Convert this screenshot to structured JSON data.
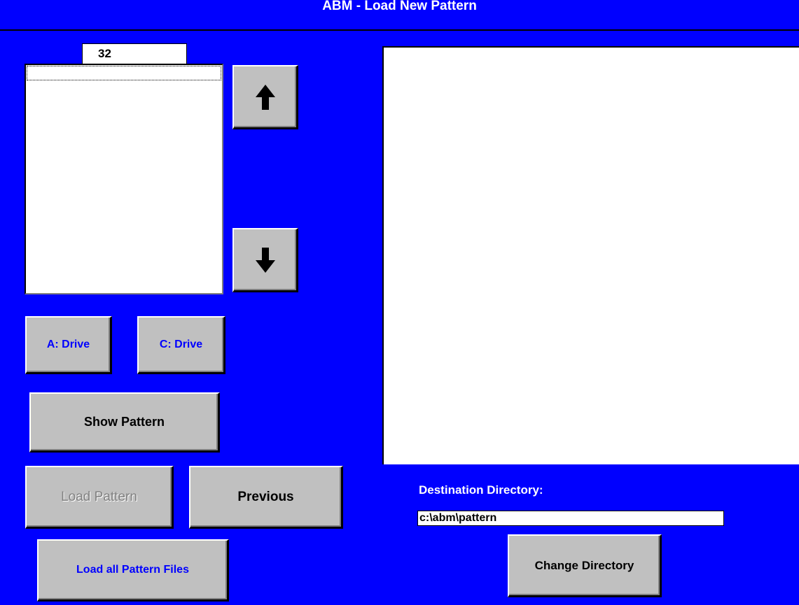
{
  "window": {
    "title": "ABM - Load New Pattern"
  },
  "file_list": {
    "counter": "32",
    "items": []
  },
  "scroll": {
    "up_icon": "arrow-up-icon",
    "down_icon": "arrow-down-icon"
  },
  "drives": {
    "a_label": "A: Drive",
    "c_label": "C: Drive"
  },
  "actions": {
    "show_pattern": "Show Pattern",
    "load_pattern": "Load Pattern",
    "previous": "Previous",
    "load_all": "Load all Pattern Files",
    "change_directory": "Change Directory"
  },
  "destination": {
    "label": "Destination Directory:",
    "value": "c:\\abm\\pattern"
  },
  "colors": {
    "background": "#0000ff",
    "button_face": "#c0c0c0",
    "button_text_accent": "#0000ff",
    "disabled_text": "#808080"
  }
}
